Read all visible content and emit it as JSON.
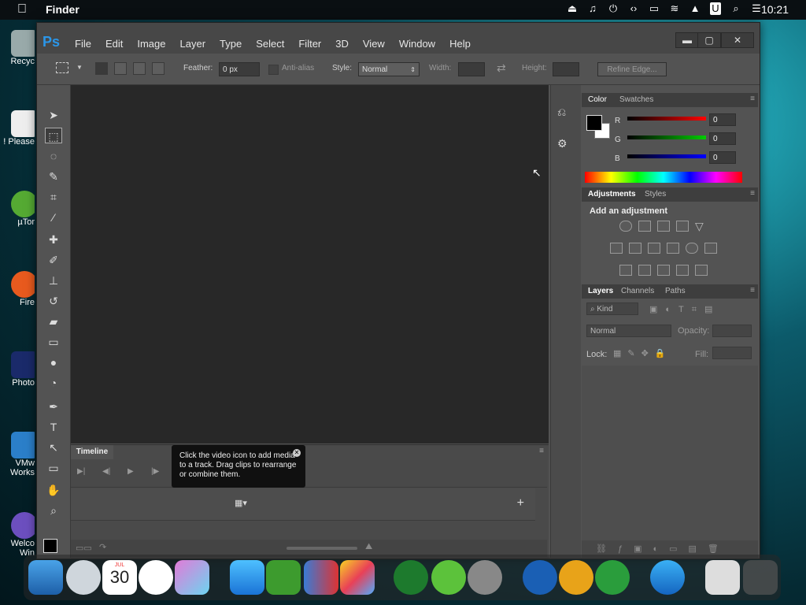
{
  "menubar": {
    "app_name": "Finder",
    "clock": "10:21",
    "status_icons": [
      "upload-icon",
      "headphones-icon",
      "power-icon",
      "code-icon",
      "display-icon",
      "wifi-off-icon",
      "eject-icon",
      "user-icon",
      "search-icon",
      "control-center-icon"
    ]
  },
  "desktop": {
    "items": [
      "Recyc",
      "! Please",
      "µTor",
      "Fire",
      "Photo",
      "VMw Works",
      "Welco Win"
    ]
  },
  "ps": {
    "logo": "Ps",
    "menu": [
      "File",
      "Edit",
      "Image",
      "Layer",
      "Type",
      "Select",
      "Filter",
      "3D",
      "View",
      "Window",
      "Help"
    ],
    "options": {
      "feather_label": "Feather:",
      "feather_value": "0 px",
      "antialias_label": "Anti-alias",
      "style_label": "Style:",
      "style_value": "Normal",
      "width_label": "Width:",
      "height_label": "Height:",
      "refine_label": "Refine Edge..."
    },
    "timeline": {
      "tab": "Timeline",
      "tooltip": "Click the video icon to add media to a track. Drag clips to rearrange or combine them."
    },
    "color_panel": {
      "tabs": [
        "Color",
        "Swatches"
      ],
      "r_label": "R",
      "g_label": "G",
      "b_label": "B",
      "r": "0",
      "g": "0",
      "b": "0"
    },
    "adjustments_panel": {
      "tabs": [
        "Adjustments",
        "Styles"
      ],
      "heading": "Add an adjustment"
    },
    "layers_panel": {
      "tabs": [
        "Layers",
        "Channels",
        "Paths"
      ],
      "kind": "Kind",
      "blend": "Normal",
      "opacity_label": "Opacity:",
      "lock_label": "Lock:",
      "fill_label": "Fill:"
    }
  },
  "dock": {
    "calendar_month": "JUL",
    "calendar_day": "30"
  }
}
